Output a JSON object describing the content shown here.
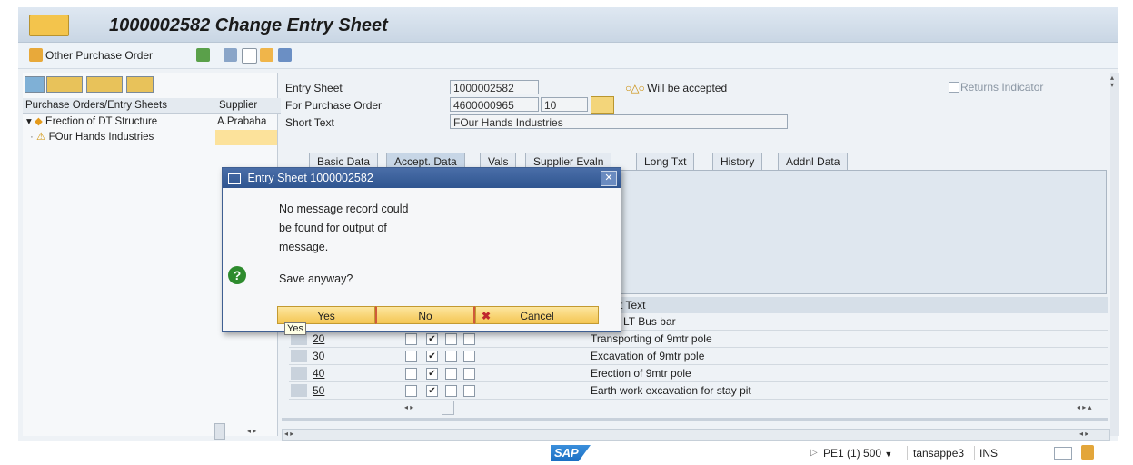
{
  "window": {
    "title": "1000002582 Change Entry Sheet"
  },
  "toolbar": {
    "other_po_label": "Other Purchase Order"
  },
  "tree": {
    "columns": [
      "Purchase Orders/Entry Sheets",
      "Supplier"
    ],
    "rows": [
      {
        "label": "Erection of DT Structure",
        "supplier": "A.Prabaha"
      },
      {
        "label": "FOur Hands Industries",
        "supplier": ""
      }
    ]
  },
  "header": {
    "entry_sheet_label": "Entry Sheet",
    "entry_sheet_value": "1000002582",
    "status_text": "Will be accepted",
    "returns_indicator_label": "Returns Indicator",
    "po_label": "For Purchase Order",
    "po_value": "4600000965",
    "po_item": "10",
    "short_text_label": "Short Text",
    "short_text_value": "FOur Hands Industries"
  },
  "tabs": [
    "Basic Data",
    "Accept. Data",
    "Vals",
    "Supplier Evaln",
    "Long Txt",
    "History",
    "Addnl Data"
  ],
  "table": {
    "header_short_text": "rt Text",
    "rows": [
      {
        "line": "",
        "text": "tion of LT Bus bar"
      },
      {
        "line": "20",
        "text": "Transporting of 9mtr pole"
      },
      {
        "line": "30",
        "text": "Excavation of 9mtr pole"
      },
      {
        "line": "40",
        "text": "Erection of 9mtr pole"
      },
      {
        "line": "50",
        "text": "Earth work excavation for stay pit"
      }
    ]
  },
  "dialog": {
    "title": "Entry Sheet 1000002582",
    "message_line1": "No message record could",
    "message_line2": "be found for output of",
    "message_line3": "message.",
    "question": "Save anyway?",
    "yes_label": "Yes",
    "no_label": "No",
    "cancel_label": "Cancel",
    "tooltip": "Yes"
  },
  "statusbar": {
    "logo": "SAP",
    "system": "PE1 (1) 500",
    "user": "tansappe3",
    "mode": "INS"
  },
  "colors": {
    "accent_blue": "#2f5590",
    "button_yellow": "#f4c552",
    "question_green": "#2e8b2e",
    "sap_blue": "#1b6fc3"
  }
}
